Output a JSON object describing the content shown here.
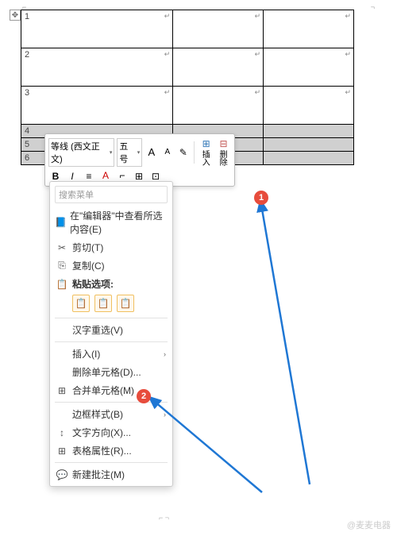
{
  "table": {
    "move_handle": "✥",
    "rows_tall": [
      "1",
      "2",
      "3"
    ],
    "rows_short": [
      "4",
      "5",
      "6"
    ],
    "para_mark": "↵"
  },
  "toolbar": {
    "font_name": "等线 (西文正文)",
    "font_size": "五号",
    "grow": "A",
    "shrink": "A",
    "format_painter": "✎",
    "bold": "B",
    "italic": "I",
    "underline": "≡",
    "font_color": "A",
    "highlight": "⌐",
    "border": "⊞",
    "align": "⊡",
    "insert_icon": "⊞",
    "insert_label": "插入",
    "delete_icon": "⊟",
    "delete_label": "删除"
  },
  "menu": {
    "search_placeholder": "搜索菜单",
    "smart_lookup": "在\"编辑器\"中查看所选内容(E)",
    "cut": "剪切(T)",
    "copy": "复制(C)",
    "paste_label": "粘贴选项:",
    "paste_opts": [
      "📋",
      "📋",
      "📋"
    ],
    "reconvert": "汉字重选(V)",
    "insert": "插入(I)",
    "delete_cells": "删除单元格(D)...",
    "merge": "合并单元格(M)",
    "border_style": "边框样式(B)",
    "text_dir": "文字方向(X)...",
    "table_props": "表格属性(R)...",
    "new_comment": "新建批注(M)"
  },
  "callouts": {
    "one": "1",
    "two": "2"
  },
  "watermark": "@麦麦电器"
}
